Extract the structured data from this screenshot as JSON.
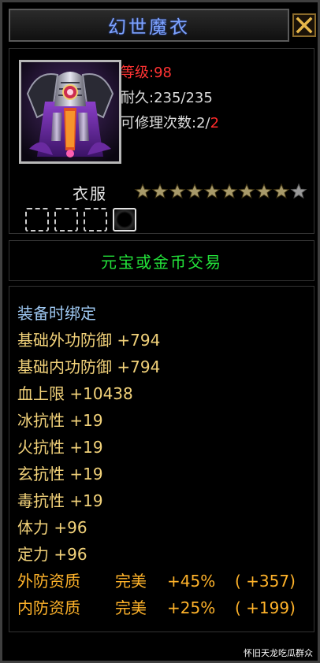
{
  "window": {
    "title": "幻世魔衣",
    "close_label": "close"
  },
  "item": {
    "icon": "purple-armor-icon",
    "level_label": "等级:",
    "level_value": "98",
    "durability": "耐久:235/235",
    "repair_label": "可修理次数:2/",
    "repair_max": "2",
    "type": "衣服",
    "stars_filled": 9,
    "stars_total": 10,
    "gem_slots": [
      "empty",
      "empty",
      "empty",
      "filled"
    ]
  },
  "trade": "元宝或金币交易",
  "attributes": {
    "bind": "装备时绑定",
    "stats": [
      "基础外功防御 +794",
      "基础内功防御 +794",
      "血上限 +10438",
      "冰抗性 +19",
      "火抗性 +19",
      "玄抗性 +19",
      "毒抗性 +19",
      "体力 +96",
      "定力 +96"
    ],
    "qualities": [
      {
        "name": "外防资质",
        "grade": "完美",
        "pct": "+45%",
        "bonus": "( +357)"
      },
      {
        "name": "内防资质",
        "grade": "完美",
        "pct": "+25%",
        "bonus": "( +199)"
      }
    ]
  },
  "watermark": "怀旧天龙吃瓜群众",
  "colors": {
    "title": "#7ea3ff",
    "level": "#ff3333",
    "trade": "#23e33a",
    "bind": "#9ec8f2",
    "stat": "#f2d27a",
    "quality": "#ffb32a",
    "star": "#a89a6a"
  }
}
